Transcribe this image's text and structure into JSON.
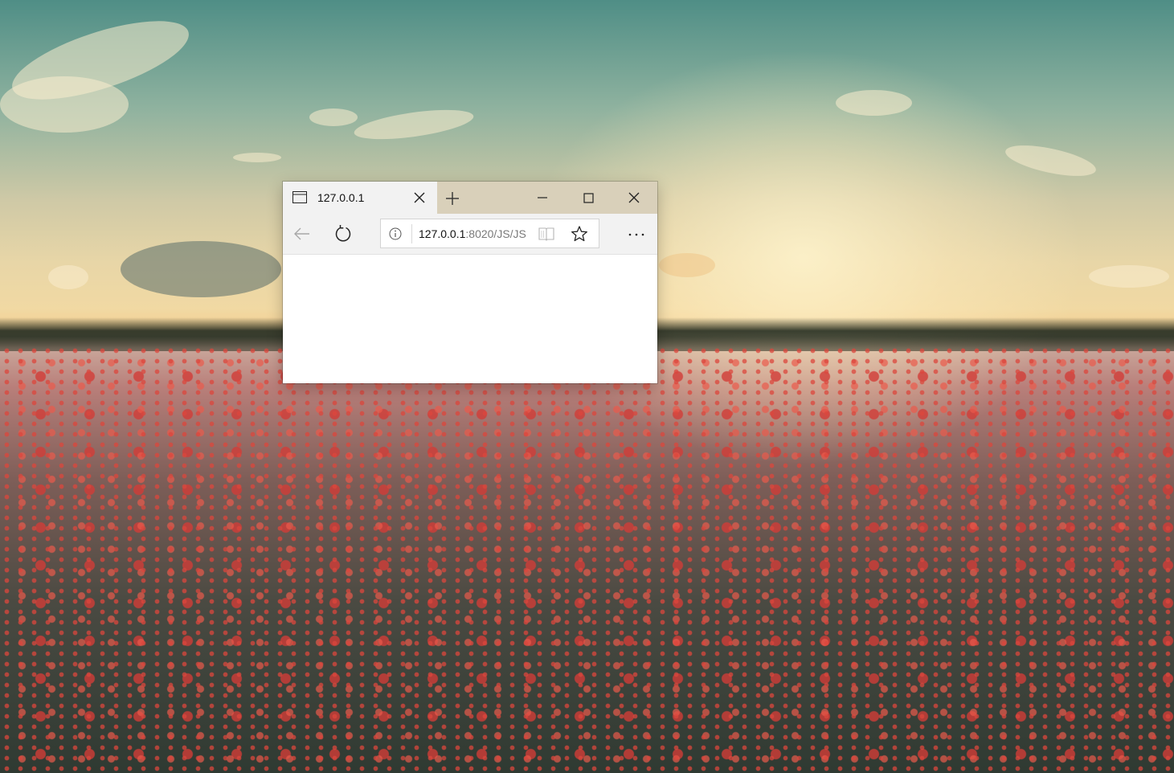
{
  "desktop": {
    "wallpaper": "poppy-field-sunset"
  },
  "browser": {
    "tab": {
      "icon": "page-icon",
      "title": "127.0.0.1",
      "close_icon": "close-icon"
    },
    "new_tab_icon": "plus-icon",
    "window_controls": {
      "minimize_icon": "minimize-icon",
      "maximize_icon": "maximize-icon",
      "close_icon": "close-icon"
    },
    "nav": {
      "back_icon": "back-arrow-icon",
      "refresh_icon": "refresh-icon",
      "more_icon": "more-icon",
      "more_label": "···"
    },
    "address": {
      "info_icon": "info-icon",
      "host": "127.0.0.1",
      "path": ":8020/JS/JS",
      "reading_view_icon": "book-icon",
      "favorite_icon": "star-icon"
    },
    "colors": {
      "chrome": "#f2f2f2",
      "titlebar": "#d6ccb4",
      "page": "#ffffff"
    }
  }
}
